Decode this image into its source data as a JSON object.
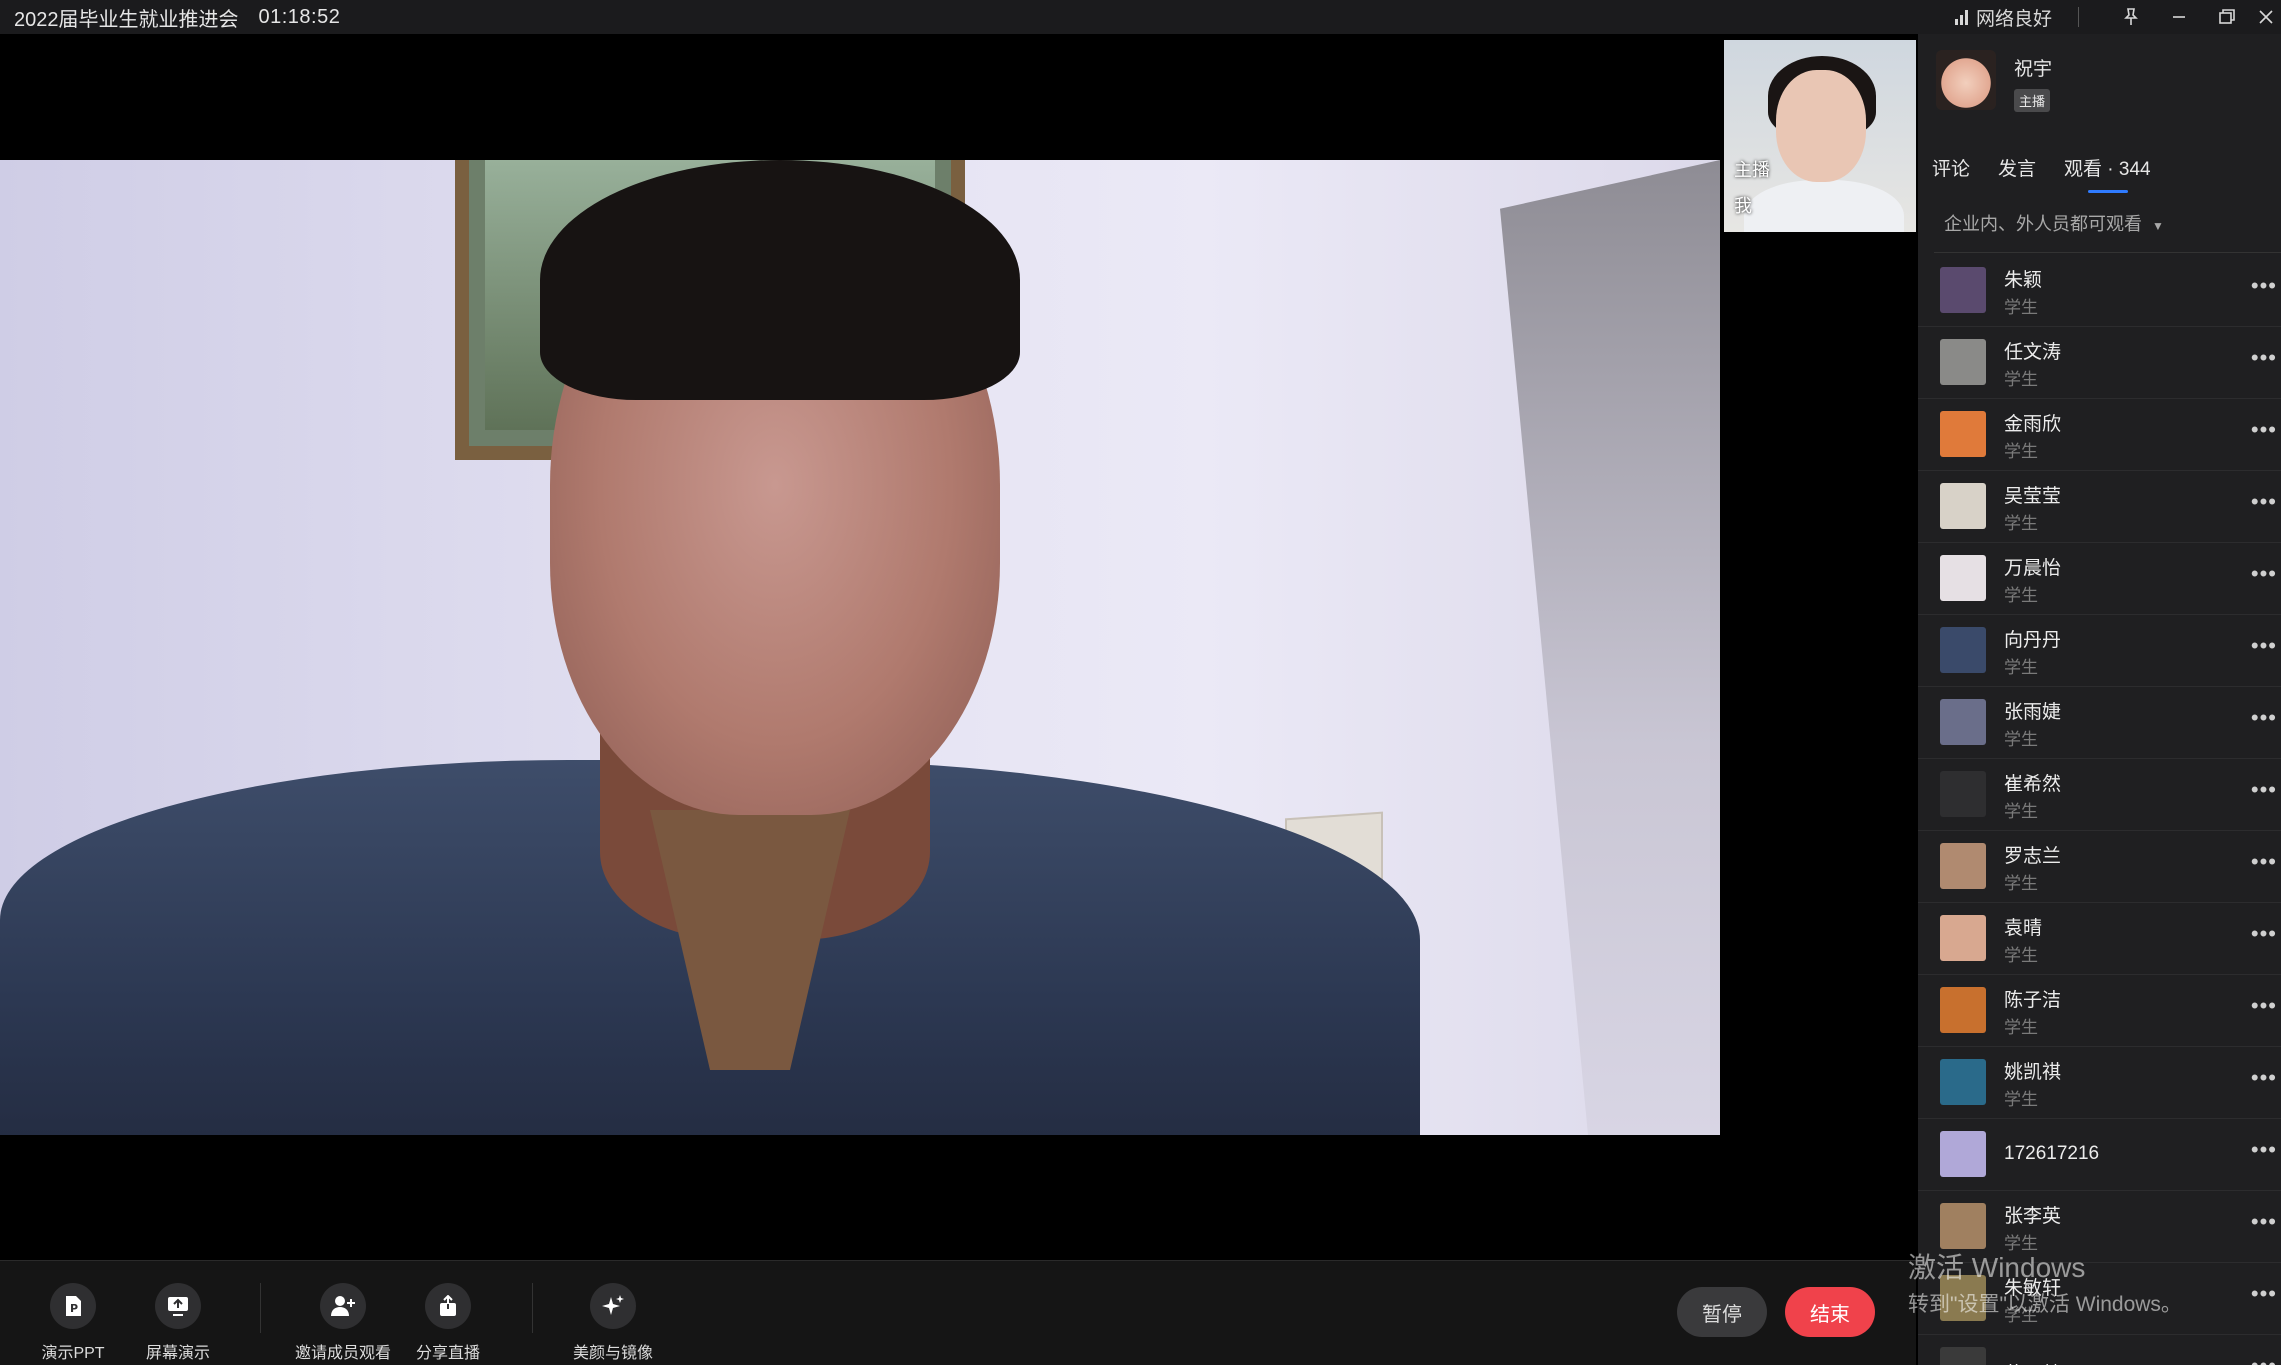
{
  "titlebar": {
    "title": "2022届毕业生就业推进会",
    "timer": "01:18:52",
    "network_status": "网络良好"
  },
  "self_preview": {
    "host_label": "主播",
    "me_label": "我"
  },
  "toolbar": {
    "items": [
      {
        "label": "演示PPT",
        "icon": "ppt-icon"
      },
      {
        "label": "屏幕演示",
        "icon": "screen-share-icon"
      },
      {
        "label": "邀请成员观看",
        "icon": "invite-user-icon"
      },
      {
        "label": "分享直播",
        "icon": "share-icon"
      },
      {
        "label": "美颜与镜像",
        "icon": "sparkle-icon"
      }
    ],
    "pause_label": "暂停",
    "end_label": "结束"
  },
  "panel": {
    "host": {
      "name": "祝宇",
      "badge": "主播"
    },
    "tabs": [
      {
        "label": "评论"
      },
      {
        "label": "发言"
      },
      {
        "label": "观看 · 344",
        "active": true
      }
    ],
    "visibility": "企业内、外人员都可观看",
    "viewers": [
      {
        "name": "朱颖",
        "role": "学生",
        "color": "#5a4a6e"
      },
      {
        "name": "任文涛",
        "role": "学生",
        "color": "#8a8a88"
      },
      {
        "name": "金雨欣",
        "role": "学生",
        "color": "#e07a3a"
      },
      {
        "name": "吴莹莹",
        "role": "学生",
        "color": "#d8d2c8"
      },
      {
        "name": "万晨怡",
        "role": "学生",
        "color": "#e6e0e4"
      },
      {
        "name": "向丹丹",
        "role": "学生",
        "color": "#3a4a6a"
      },
      {
        "name": "张雨婕",
        "role": "学生",
        "color": "#6a6e8a"
      },
      {
        "name": "崔希然",
        "role": "学生",
        "color": "#2e2e30"
      },
      {
        "name": "罗志兰",
        "role": "学生",
        "color": "#b08a70"
      },
      {
        "name": "袁晴",
        "role": "学生",
        "color": "#d8a890"
      },
      {
        "name": "陈子洁",
        "role": "学生",
        "color": "#c8702e"
      },
      {
        "name": "姚凯祺",
        "role": "学生",
        "color": "#2a6a8a"
      },
      {
        "name": "172617216",
        "role": "",
        "color": "#b0a8d8"
      },
      {
        "name": "张李英",
        "role": "学生",
        "color": "#a08060"
      },
      {
        "name": "朱敏轩",
        "role": "学生",
        "color": "#8a7a50"
      },
      {
        "name": "黄明慧",
        "role": "",
        "color": "#3a3a3a"
      }
    ]
  },
  "watermark": {
    "line1": "激活 Windows",
    "line2": "转到\"设置\"以激活 Windows。"
  }
}
